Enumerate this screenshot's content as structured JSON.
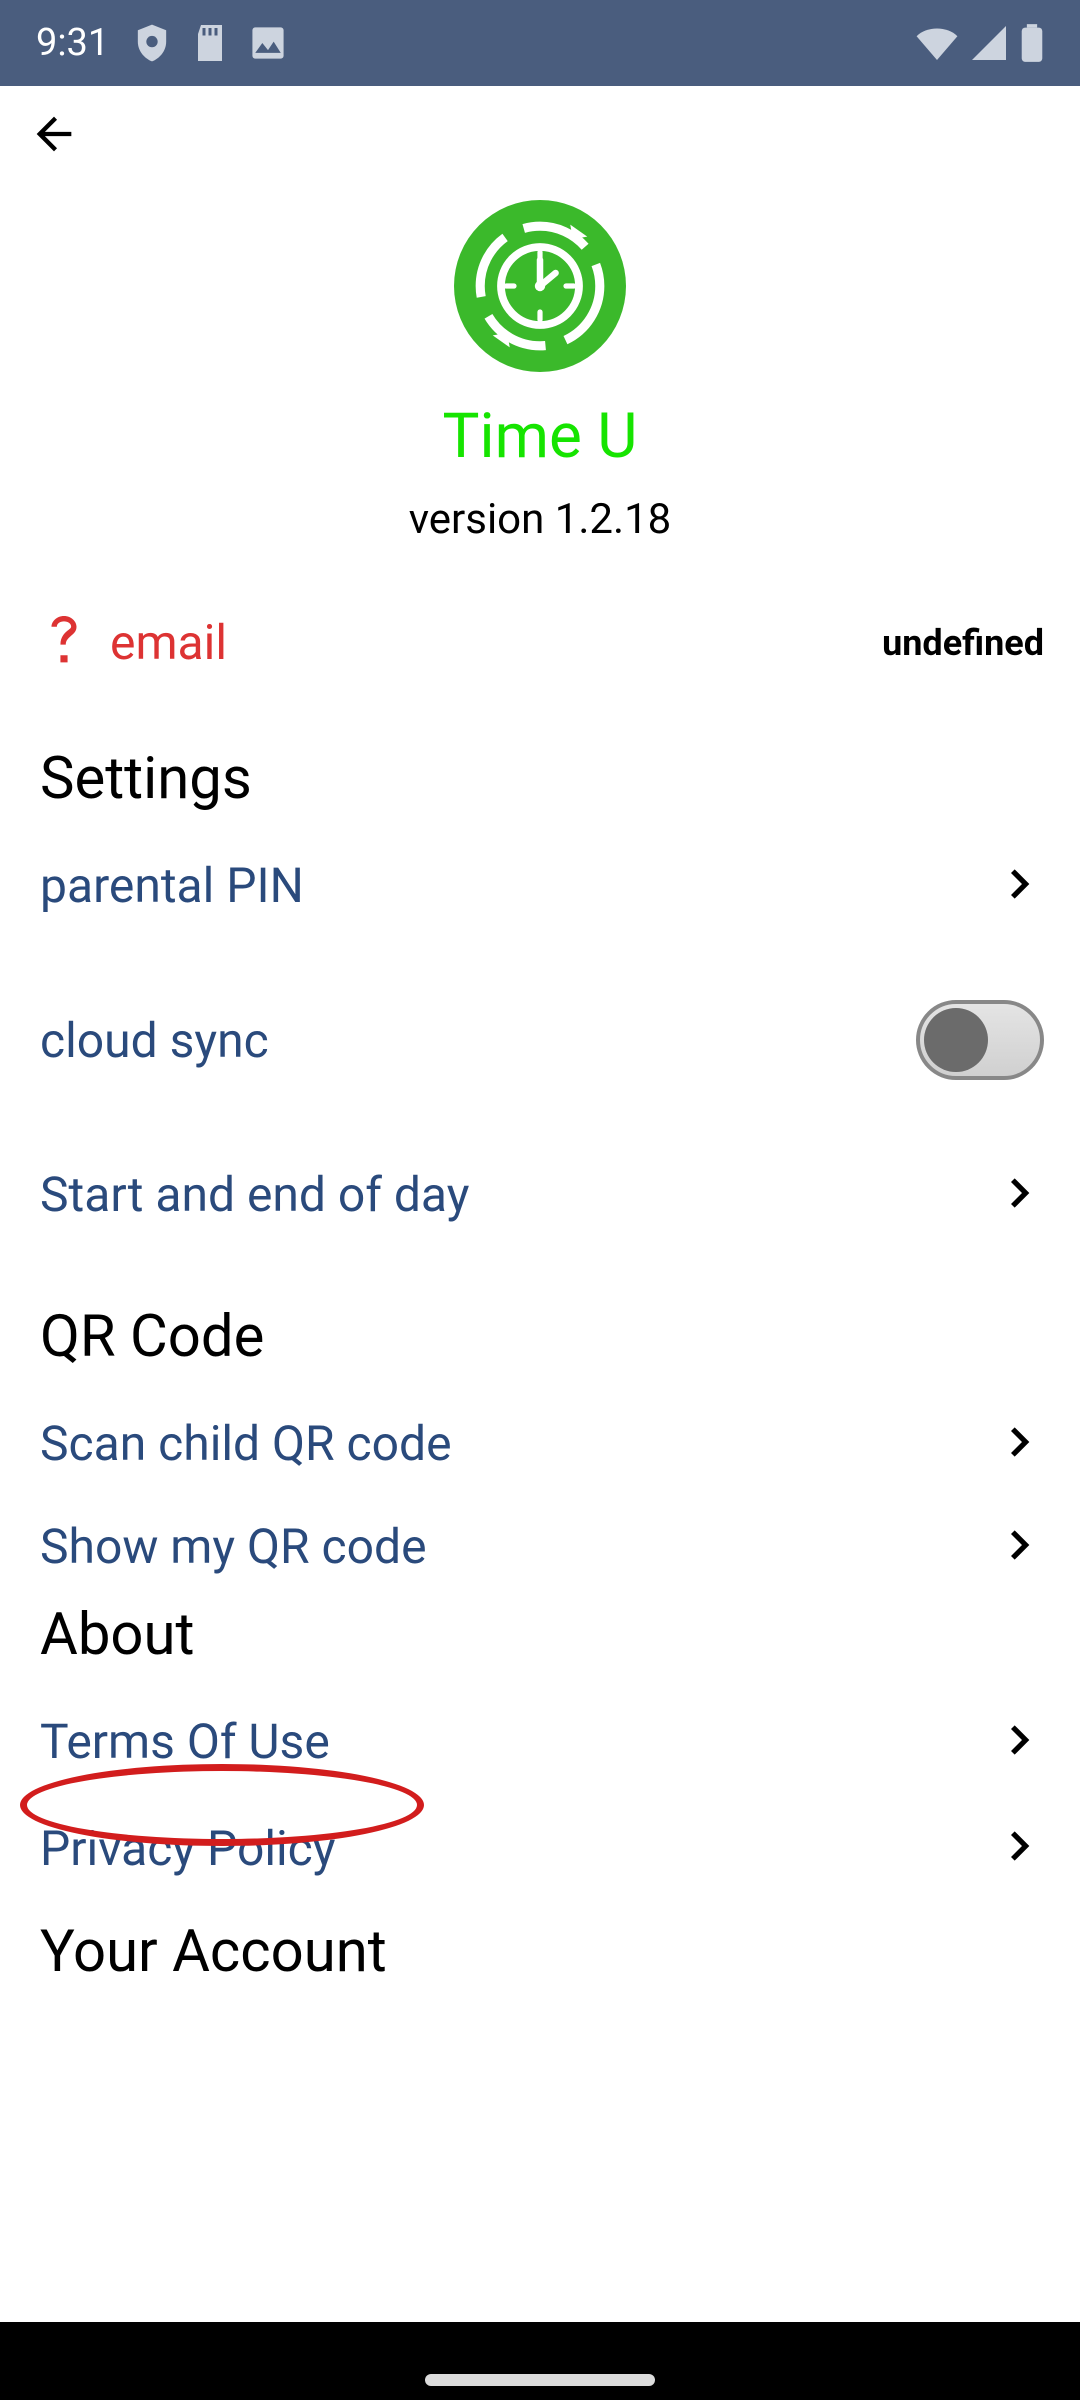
{
  "status": {
    "time": "9:31"
  },
  "header": {
    "app_name": "Time U",
    "version": "version 1.2.18"
  },
  "account": {
    "email_label": "email",
    "email_value": "undefined"
  },
  "sections": {
    "settings_title": "Settings",
    "qr_title": "QR Code",
    "about_title": "About",
    "your_account_title": "Your Account"
  },
  "rows": {
    "parental_pin": "parental PIN",
    "cloud_sync": "cloud sync",
    "cloud_sync_on": false,
    "start_end_day": "Start and end of day",
    "scan_child_qr": "Scan child QR code",
    "show_my_qr": "Show my QR code",
    "terms": "Terms Of Use",
    "privacy": "Privacy Policy"
  },
  "colors": {
    "statusbar": "#4a5d7e",
    "link": "#2a4a7c",
    "brand_green": "#3bb92b",
    "brand_name": "#16e400",
    "highlight": "#d21d1d"
  }
}
